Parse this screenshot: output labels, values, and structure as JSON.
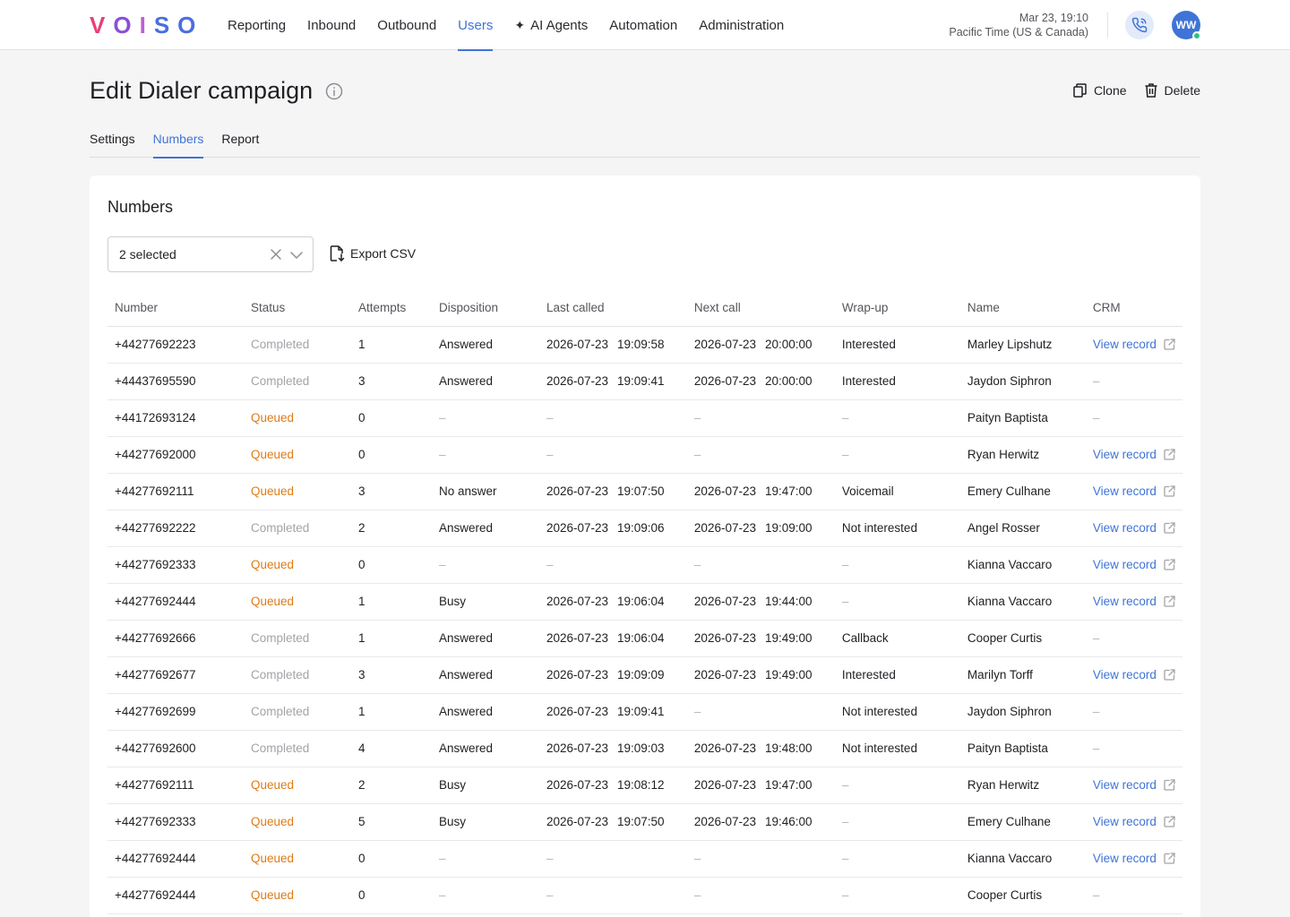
{
  "brand": {
    "letters": [
      "V",
      "O",
      "I",
      "S",
      "O"
    ]
  },
  "nav": [
    {
      "label": "Reporting",
      "active": false
    },
    {
      "label": "Inbound",
      "active": false
    },
    {
      "label": "Outbound",
      "active": false
    },
    {
      "label": "Users",
      "active": true
    },
    {
      "label": "AI Agents",
      "active": false,
      "icon": "sparkle-icon"
    },
    {
      "label": "Automation",
      "active": false
    },
    {
      "label": "Administration",
      "active": false
    }
  ],
  "header": {
    "date": "Mar 23, 19:10",
    "timezone": "Pacific Time (US & Canada)",
    "avatar_initials": "WW"
  },
  "page": {
    "title": "Edit Dialer campaign",
    "clone_label": "Clone",
    "delete_label": "Delete"
  },
  "tabs": [
    {
      "label": "Settings",
      "active": false
    },
    {
      "label": "Numbers",
      "active": true
    },
    {
      "label": "Report",
      "active": false
    }
  ],
  "numbers": {
    "title": "Numbers",
    "filter_value": "2 selected",
    "export_label": "Export CSV",
    "columns": [
      "Number",
      "Status",
      "Attempts",
      "Disposition",
      "Last called",
      "Next call",
      "Wrap-up",
      "Name",
      "CRM"
    ],
    "rows": [
      {
        "number": "+44277692223",
        "status": "Completed",
        "attempts": "1",
        "disposition": "Answered",
        "last_date": "2026-07-23",
        "last_time": "19:09:58",
        "next_date": "2026-07-23",
        "next_time": "20:00:00",
        "wrapup": "Interested",
        "name": "Marley Lipshutz",
        "crm": "View record"
      },
      {
        "number": "+44437695590",
        "status": "Completed",
        "attempts": "3",
        "disposition": "Answered",
        "last_date": "2026-07-23",
        "last_time": "19:09:41",
        "next_date": "2026-07-23",
        "next_time": "20:00:00",
        "wrapup": "Interested",
        "name": "Jaydon Siphron",
        "crm": ""
      },
      {
        "number": "+44172693124",
        "status": "Queued",
        "attempts": "0",
        "disposition": "",
        "last_date": "",
        "last_time": "",
        "next_date": "",
        "next_time": "",
        "wrapup": "",
        "name": "Paityn Baptista",
        "crm": ""
      },
      {
        "number": "+44277692000",
        "status": "Queued",
        "attempts": "0",
        "disposition": "",
        "last_date": "",
        "last_time": "",
        "next_date": "",
        "next_time": "",
        "wrapup": "",
        "name": "Ryan Herwitz",
        "crm": "View record"
      },
      {
        "number": "+44277692111",
        "status": "Queued",
        "attempts": "3",
        "disposition": "No answer",
        "last_date": "2026-07-23",
        "last_time": "19:07:50",
        "next_date": "2026-07-23",
        "next_time": "19:47:00",
        "wrapup": "Voicemail",
        "name": "Emery Culhane",
        "crm": "View record"
      },
      {
        "number": "+44277692222",
        "status": "Completed",
        "attempts": "2",
        "disposition": "Answered",
        "last_date": "2026-07-23",
        "last_time": "19:09:06",
        "next_date": "2026-07-23",
        "next_time": "19:09:00",
        "wrapup": "Not interested",
        "name": "Angel Rosser",
        "crm": "View record"
      },
      {
        "number": "+44277692333",
        "status": "Queued",
        "attempts": "0",
        "disposition": "",
        "last_date": "",
        "last_time": "",
        "next_date": "",
        "next_time": "",
        "wrapup": "",
        "name": "Kianna Vaccaro",
        "crm": "View record"
      },
      {
        "number": "+44277692444",
        "status": "Queued",
        "attempts": "1",
        "disposition": "Busy",
        "last_date": "2026-07-23",
        "last_time": "19:06:04",
        "next_date": "2026-07-23",
        "next_time": "19:44:00",
        "wrapup": "",
        "name": "Kianna Vaccaro",
        "crm": "View record"
      },
      {
        "number": "+44277692666",
        "status": "Completed",
        "attempts": "1",
        "disposition": "Answered",
        "last_date": "2026-07-23",
        "last_time": "19:06:04",
        "next_date": "2026-07-23",
        "next_time": "19:49:00",
        "wrapup": "Callback",
        "name": "Cooper Curtis",
        "crm": ""
      },
      {
        "number": "+44277692677",
        "status": "Completed",
        "attempts": "3",
        "disposition": "Answered",
        "last_date": "2026-07-23",
        "last_time": "19:09:09",
        "next_date": "2026-07-23",
        "next_time": "19:49:00",
        "wrapup": "Interested",
        "name": "Marilyn Torff",
        "crm": "View record"
      },
      {
        "number": "+44277692699",
        "status": "Completed",
        "attempts": "1",
        "disposition": "Answered",
        "last_date": "2026-07-23",
        "last_time": "19:09:41",
        "next_date": "",
        "next_time": "",
        "wrapup": "Not interested",
        "name": "Jaydon Siphron",
        "crm": ""
      },
      {
        "number": "+44277692600",
        "status": "Completed",
        "attempts": "4",
        "disposition": "Answered",
        "last_date": "2026-07-23",
        "last_time": "19:09:03",
        "next_date": "2026-07-23",
        "next_time": "19:48:00",
        "wrapup": "Not interested",
        "name": "Paityn Baptista",
        "crm": ""
      },
      {
        "number": "+44277692111",
        "status": "Queued",
        "attempts": "2",
        "disposition": "Busy",
        "last_date": "2026-07-23",
        "last_time": "19:08:12",
        "next_date": "2026-07-23",
        "next_time": "19:47:00",
        "wrapup": "",
        "name": "Ryan Herwitz",
        "crm": "View record"
      },
      {
        "number": "+44277692333",
        "status": "Queued",
        "attempts": "5",
        "disposition": "Busy",
        "last_date": "2026-07-23",
        "last_time": "19:07:50",
        "next_date": "2026-07-23",
        "next_time": "19:46:00",
        "wrapup": "",
        "name": "Emery Culhane",
        "crm": "View record"
      },
      {
        "number": "+44277692444",
        "status": "Queued",
        "attempts": "0",
        "disposition": "",
        "last_date": "",
        "last_time": "",
        "next_date": "",
        "next_time": "",
        "wrapup": "",
        "name": "Kianna Vaccaro",
        "crm": "View record"
      },
      {
        "number": "+44277692444",
        "status": "Queued",
        "attempts": "0",
        "disposition": "",
        "last_date": "",
        "last_time": "",
        "next_date": "",
        "next_time": "",
        "wrapup": "",
        "name": "Cooper Curtis",
        "crm": ""
      }
    ]
  },
  "colors": {
    "accent": "#3f74d6",
    "queued": "#e07a14",
    "completed": "#a3a3a9",
    "online": "#2ec27e"
  }
}
